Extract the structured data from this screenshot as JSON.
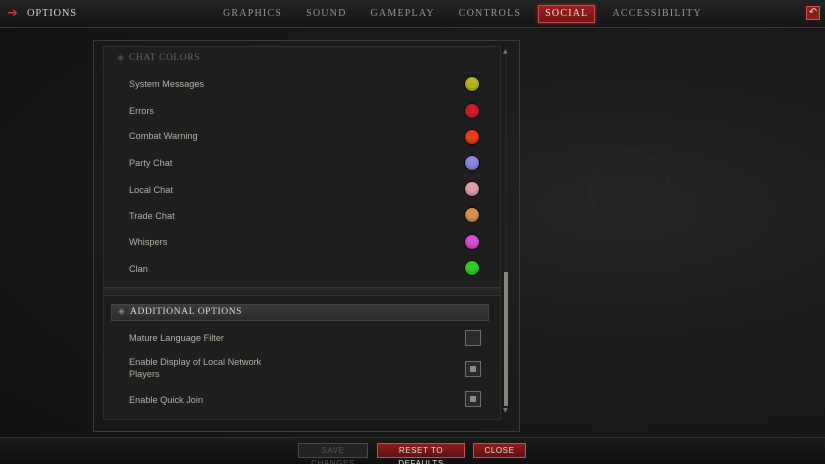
{
  "header": {
    "title": "OPTIONS",
    "back_icon": "arrow-right-icon",
    "undo_icon": "undo-icon",
    "tabs": [
      {
        "label": "GRAPHICS",
        "active": false
      },
      {
        "label": "SOUND",
        "active": false
      },
      {
        "label": "GAMEPLAY",
        "active": false
      },
      {
        "label": "CONTROLS",
        "active": false
      },
      {
        "label": "SOCIAL",
        "active": true
      },
      {
        "label": "ACCESSIBILITY",
        "active": false
      }
    ]
  },
  "chat_colors": {
    "heading": "CHAT COLORS",
    "items": [
      {
        "label": "System Messages",
        "color": "#b5b51e"
      },
      {
        "label": "Errors",
        "color": "#cc1d2c"
      },
      {
        "label": "Combat Warning",
        "color": "#e8401e"
      },
      {
        "label": "Party Chat",
        "color": "#8a88e0"
      },
      {
        "label": "Local Chat",
        "color": "#e0a0a8"
      },
      {
        "label": "Trade Chat",
        "color": "#d9904c"
      },
      {
        "label": "Whispers",
        "color": "#d94ed4"
      },
      {
        "label": "Clan",
        "color": "#2ecc2a"
      }
    ]
  },
  "additional_options": {
    "heading": "ADDITIONAL OPTIONS",
    "items": [
      {
        "label": "Mature Language Filter",
        "checked": false
      },
      {
        "label": "Enable Display of Local Network Players",
        "checked": true
      },
      {
        "label": "Enable Quick Join",
        "checked": true
      }
    ]
  },
  "footer": {
    "save_label": "SAVE CHANGES",
    "reset_label": "RESET TO DEFAULTS",
    "close_label": "CLOSE"
  },
  "colors": {
    "accent": "#8d1d1b",
    "accent_border": "#c85048"
  }
}
